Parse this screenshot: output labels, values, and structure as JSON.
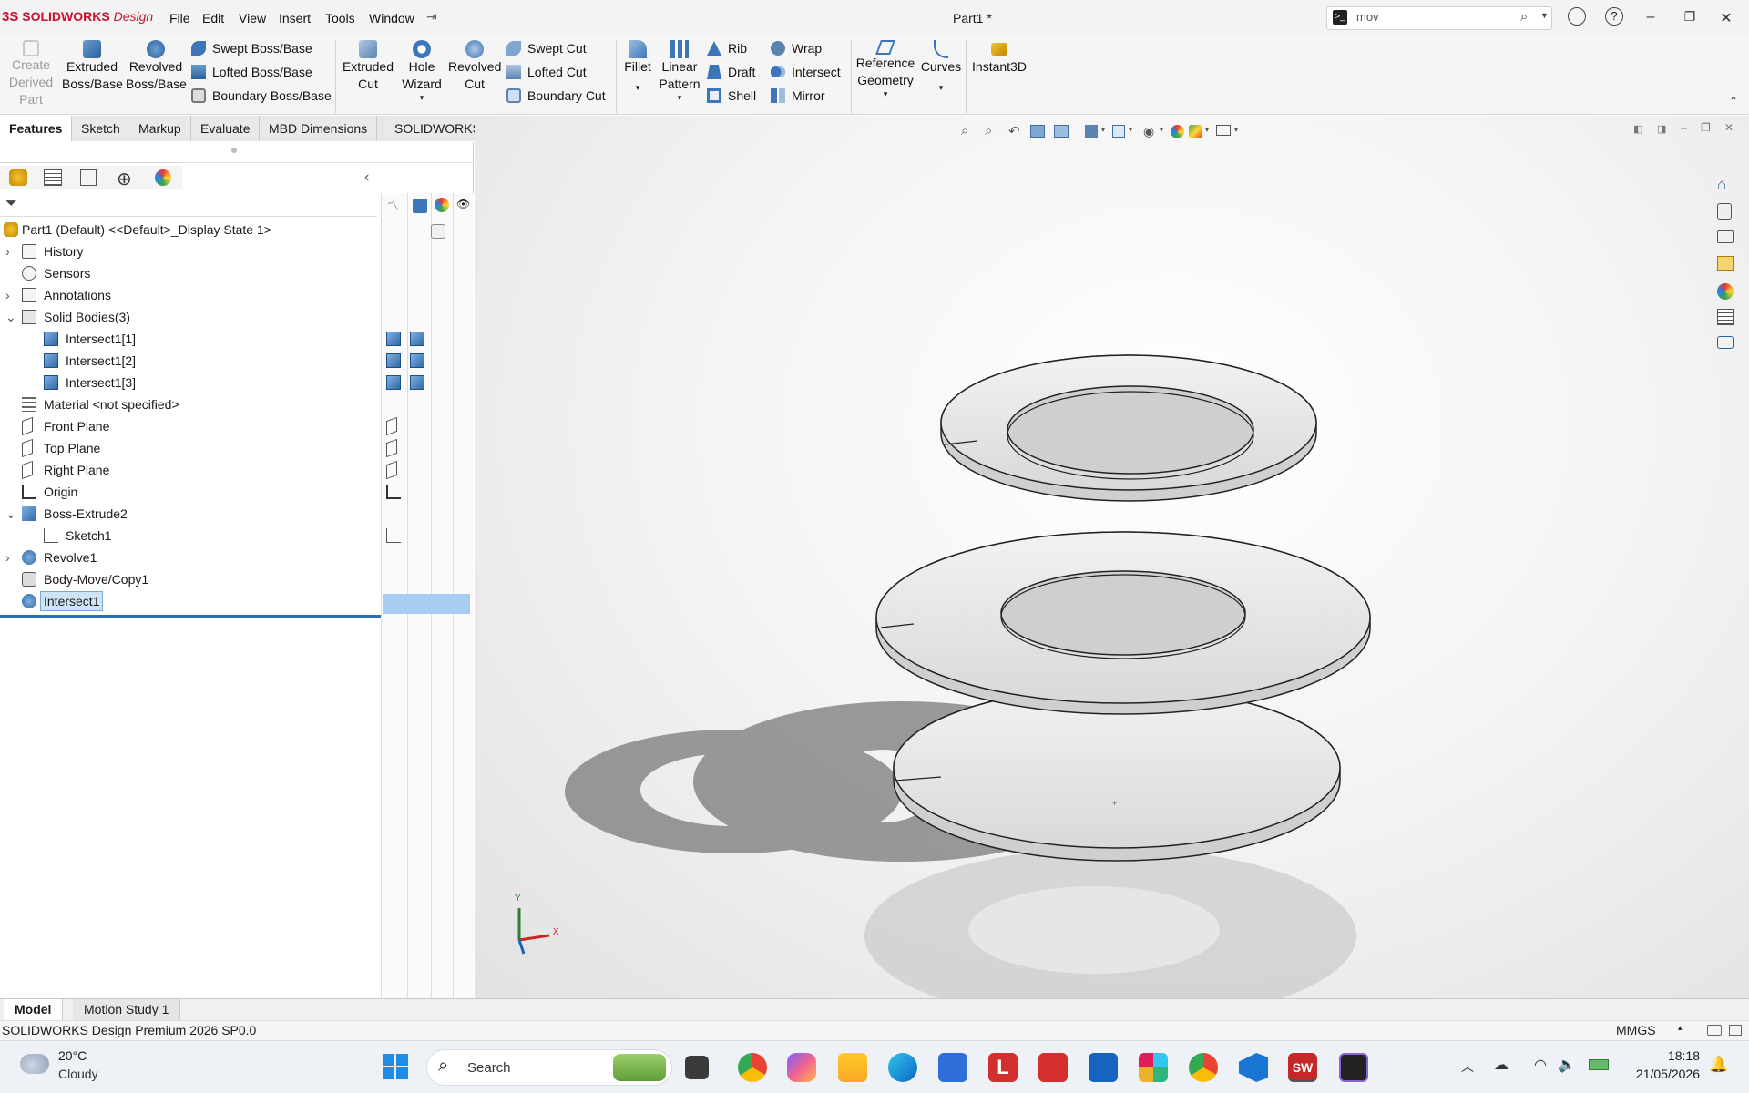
{
  "app": {
    "brand": "SOLIDWORKS",
    "brand_suffix": "Design",
    "doc_title": "Part1 *"
  },
  "menu": [
    "File",
    "Edit",
    "View",
    "Insert",
    "Tools",
    "Window"
  ],
  "search": {
    "value": "mov"
  },
  "ribbon": {
    "create_derived": "Create\nDerived\nPart",
    "extruded_boss": "Extruded\nBoss/Base",
    "revolved_boss": "Revolved\nBoss/Base",
    "swept_boss": "Swept Boss/Base",
    "lofted_boss": "Lofted Boss/Base",
    "boundary_boss": "Boundary Boss/Base",
    "extruded_cut": "Extruded\nCut",
    "hole_wizard": "Hole\nWizard",
    "revolved_cut": "Revolved\nCut",
    "swept_cut": "Swept Cut",
    "lofted_cut": "Lofted Cut",
    "boundary_cut": "Boundary Cut",
    "fillet": "Fillet",
    "linear_pattern": "Linear\nPattern",
    "rib": "Rib",
    "draft": "Draft",
    "shell": "Shell",
    "wrap": "Wrap",
    "intersect": "Intersect",
    "mirror": "Mirror",
    "reference_geometry": "Reference\nGeometry",
    "curves": "Curves",
    "instant3d": "Instant3D"
  },
  "tabs": [
    "Features",
    "Sketch",
    "Markup",
    "Evaluate",
    "MBD Dimensions",
    "SOLIDWORKS Add-Ins"
  ],
  "tree": {
    "root": "Part1 (Default) <<Default>_Display State 1>",
    "items": [
      {
        "label": "History",
        "icon": "history-icon",
        "level": 1,
        "expand": "right"
      },
      {
        "label": "Sensors",
        "icon": "sensors-icon",
        "level": 1,
        "expand": ""
      },
      {
        "label": "Annotations",
        "icon": "annotations-icon",
        "level": 1,
        "expand": "right"
      },
      {
        "label": "Solid Bodies(3)",
        "icon": "solid-bodies-icon",
        "level": 1,
        "expand": "down"
      },
      {
        "label": "Intersect1[1]",
        "icon": "body-icon",
        "level": 2,
        "expand": ""
      },
      {
        "label": "Intersect1[2]",
        "icon": "body-icon",
        "level": 2,
        "expand": ""
      },
      {
        "label": "Intersect1[3]",
        "icon": "body-icon",
        "level": 2,
        "expand": ""
      },
      {
        "label": "Material <not specified>",
        "icon": "material-icon",
        "level": 1,
        "expand": ""
      },
      {
        "label": "Front Plane",
        "icon": "plane-icon",
        "level": 1,
        "expand": ""
      },
      {
        "label": "Top Plane",
        "icon": "plane-icon",
        "level": 1,
        "expand": ""
      },
      {
        "label": "Right Plane",
        "icon": "plane-icon",
        "level": 1,
        "expand": ""
      },
      {
        "label": "Origin",
        "icon": "origin-icon",
        "level": 1,
        "expand": ""
      },
      {
        "label": "Boss-Extrude2",
        "icon": "extrude-icon",
        "level": 1,
        "expand": "down"
      },
      {
        "label": "Sketch1",
        "icon": "sketch-icon",
        "level": 2,
        "expand": ""
      },
      {
        "label": "Revolve1",
        "icon": "revolve-icon",
        "level": 1,
        "expand": "right"
      },
      {
        "label": "Body-Move/Copy1",
        "icon": "move-copy-icon",
        "level": 1,
        "expand": ""
      },
      {
        "label": "Intersect1",
        "icon": "intersect-icon",
        "level": 1,
        "expand": "",
        "selected": true
      }
    ]
  },
  "bottom_tabs": [
    "Model",
    "Motion Study 1"
  ],
  "status": {
    "text": "SOLIDWORKS Design Premium 2026 SP0.0",
    "units": "MMGS"
  },
  "taskbar": {
    "weather_temp": "20°C",
    "weather_text": "Cloudy",
    "search": "Search",
    "time": "18:18",
    "date": "21/05/2026"
  },
  "triad": {
    "y": "Y",
    "x": "X"
  },
  "colors": {
    "accent": "#c8102e",
    "selection": "#cfe3f7",
    "highlight_bar": "#a9cdf0"
  }
}
